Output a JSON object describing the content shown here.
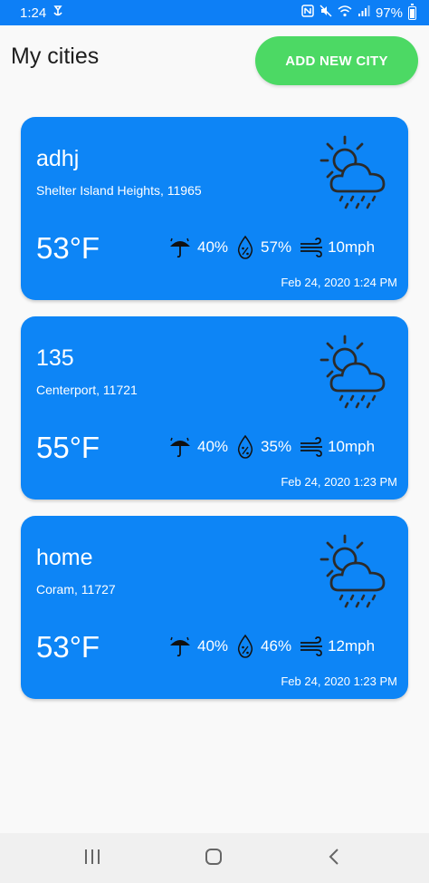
{
  "status_bar": {
    "time": "1:24",
    "battery": "97%",
    "icons": [
      "app-notification-icon",
      "nfc-icon",
      "mute-icon",
      "wifi-icon",
      "signal-icon",
      "battery-icon"
    ]
  },
  "header": {
    "title": "My cities",
    "add_button": "ADD NEW CITY"
  },
  "colors": {
    "accent": "#0d85f6",
    "status_bar": "#0d7ff6",
    "add_button": "#4cd964",
    "icon_stroke": "#2b2b2b"
  },
  "cities": [
    {
      "name": "adhj",
      "location": "Shelter Island Heights, 11965",
      "temperature": "53°F",
      "precipitation": "40%",
      "humidity": "57%",
      "wind": "10mph",
      "updated": "Feb 24, 2020 1:24 PM",
      "weather_icon": "partly-cloudy-rain-icon"
    },
    {
      "name": "135",
      "location": "Centerport, 11721",
      "temperature": "55°F",
      "precipitation": "40%",
      "humidity": "35%",
      "wind": "10mph",
      "updated": "Feb 24, 2020 1:23 PM",
      "weather_icon": "partly-cloudy-rain-icon"
    },
    {
      "name": "home",
      "location": "Coram, 11727",
      "temperature": "53°F",
      "precipitation": "40%",
      "humidity": "46%",
      "wind": "12mph",
      "updated": "Feb 24, 2020 1:23 PM",
      "weather_icon": "partly-cloudy-rain-icon"
    }
  ],
  "nav_bar": {
    "buttons": [
      "recent-apps-icon",
      "home-icon",
      "back-icon"
    ]
  }
}
